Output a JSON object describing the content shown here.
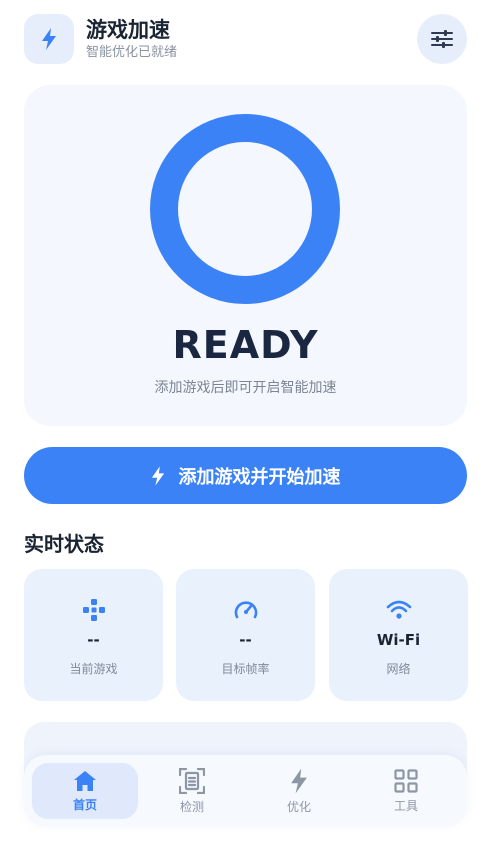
{
  "header": {
    "title": "游戏加速",
    "subtitle": "智能优化已就绪",
    "app_icon": "bolt-icon",
    "settings_icon": "sliders-icon"
  },
  "hero": {
    "status": "READY",
    "hint": "添加游戏后即可开启智能加速"
  },
  "cta": {
    "label": "添加游戏并开始加速",
    "icon": "bolt-icon"
  },
  "section": {
    "title": "实时状态"
  },
  "status_cards": [
    {
      "icon": "gamepad-icon",
      "value": "--",
      "label": "当前游戏"
    },
    {
      "icon": "speedometer-icon",
      "value": "--",
      "label": "目标帧率"
    },
    {
      "icon": "wifi-icon",
      "value": "Wi-Fi",
      "label": "网络"
    }
  ],
  "nav": {
    "items": [
      {
        "icon": "home-icon",
        "label": "首页",
        "active": true
      },
      {
        "icon": "scan-icon",
        "label": "检测",
        "active": false
      },
      {
        "icon": "bolt-icon",
        "label": "优化",
        "active": false
      },
      {
        "icon": "grid-icon",
        "label": "工具",
        "active": false
      }
    ]
  },
  "colors": {
    "accent": "#3b82f6",
    "card_bg": "#e9f1fd",
    "hero_bg": "#f4f7fd",
    "text_dark": "#1b2433",
    "text_muted": "#808998"
  }
}
